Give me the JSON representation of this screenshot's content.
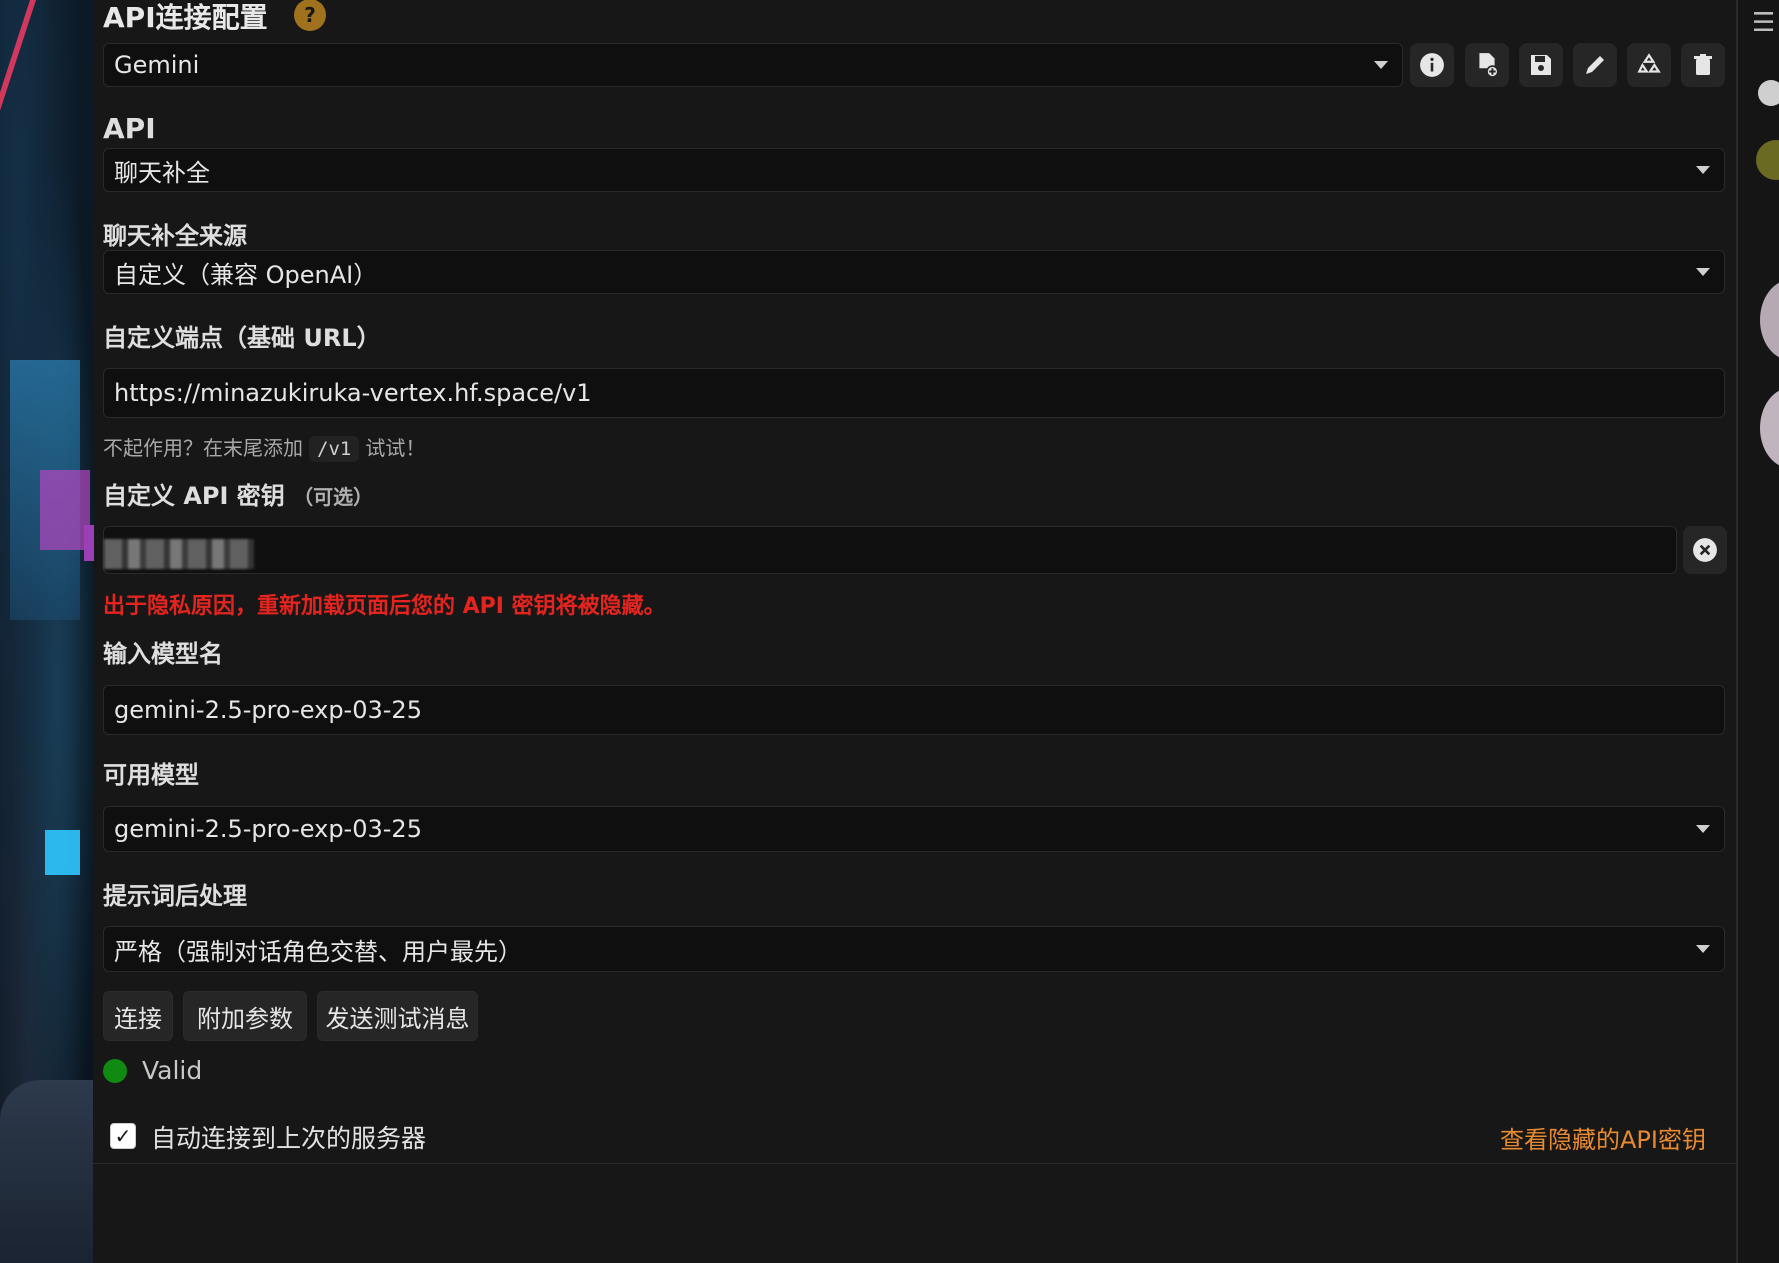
{
  "header": {
    "title": "API连接配置",
    "help_icon": "?",
    "profile_select_value": "Gemini",
    "icons": [
      "info-icon",
      "file-add-icon",
      "save-icon",
      "pencil-icon",
      "recycle-icon",
      "trash-icon"
    ]
  },
  "api": {
    "label": "API",
    "value": "聊天补全"
  },
  "source": {
    "label": "聊天补全来源",
    "value": "自定义（兼容 OpenAI）"
  },
  "endpoint": {
    "label": "自定义端点（基础 URL）",
    "value": "https://minazukiruka-vertex.hf.space/v1",
    "hint_prefix": "不起作用？在末尾添加",
    "hint_code": "/v1",
    "hint_suffix": "试试！"
  },
  "api_key": {
    "label": "自定义 API 密钥",
    "label_note": "（可选）",
    "warning": "出于隐私原因，重新加载页面后您的 API 密钥将被隐藏。"
  },
  "model_input": {
    "label": "输入模型名",
    "value": "gemini-2.5-pro-exp-03-25"
  },
  "available_models": {
    "label": "可用模型",
    "value": "gemini-2.5-pro-exp-03-25"
  },
  "postprocess": {
    "label": "提示词后处理",
    "value": "严格（强制对话角色交替、用户最先）"
  },
  "actions": {
    "connect": "连接",
    "extra_params": "附加参数",
    "send_test": "发送测试消息"
  },
  "status": {
    "text": "Valid",
    "color": "#118a11"
  },
  "auto_connect": {
    "label": "自动连接到上次的服务器",
    "checked": true
  },
  "view_hidden_keys": "查看隐藏的API密钥",
  "colors": {
    "accent_orange": "#e88a2f",
    "warning_red": "#e3241f",
    "help_badge": "#a0721e"
  }
}
